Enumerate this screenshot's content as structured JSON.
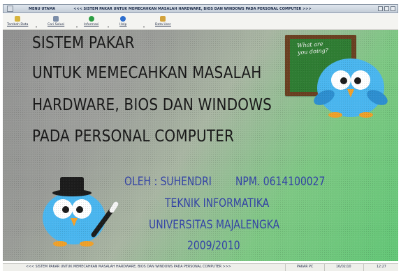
{
  "window": {
    "menu_label": "MENU UTAMA",
    "title": "<<< SISTEM PAKAR UNTUK MEMECAHKAN MASALAH HARDWARE, BIOS DAN WINDOWS PADA PERSONAL COMPUTER >>>"
  },
  "toolbar": {
    "items": [
      {
        "label": "Tambah Data",
        "icon": "add-data-icon",
        "color": "#d7b43d"
      },
      {
        "label": "Cari Solusi",
        "icon": "binoculars-icon",
        "color": "#7d8ea9"
      },
      {
        "label": "Informasi",
        "icon": "information-icon",
        "color": "#2d9e45"
      },
      {
        "label": "Help",
        "icon": "help-icon",
        "color": "#2f6fcf"
      },
      {
        "label": "Data User",
        "icon": "data-user-icon",
        "color": "#d3a33d"
      }
    ]
  },
  "main": {
    "heading_lines": [
      "SISTEM PAKAR",
      "UNTUK MEMECAHKAN MASALAH",
      "HARDWARE, BIOS DAN WINDOWS",
      "PADA PERSONAL COMPUTER"
    ],
    "author": "OLEH : SUHENDRI",
    "npm": "NPM. 0614100027",
    "major": "TEKNIK INFORMATIKA",
    "university": "UNIVERSITAS MAJALENGKA",
    "year": "2009/2010",
    "board_text": "What are you doing?"
  },
  "status": {
    "title": "<<< SISTEM PAKAR UNTUK MEMECAHKAN MASALAH HARDWARE, BIOS DAN WINDOWS PADA PERSONAL COMPUTER >>>",
    "app": "PAKAR PC",
    "date": "16/02/10",
    "time": "12:27"
  },
  "colors": {
    "heading": "#181818",
    "info": "#3343a7",
    "board": "#2f7d33",
    "bird": "#4ab6ef"
  }
}
